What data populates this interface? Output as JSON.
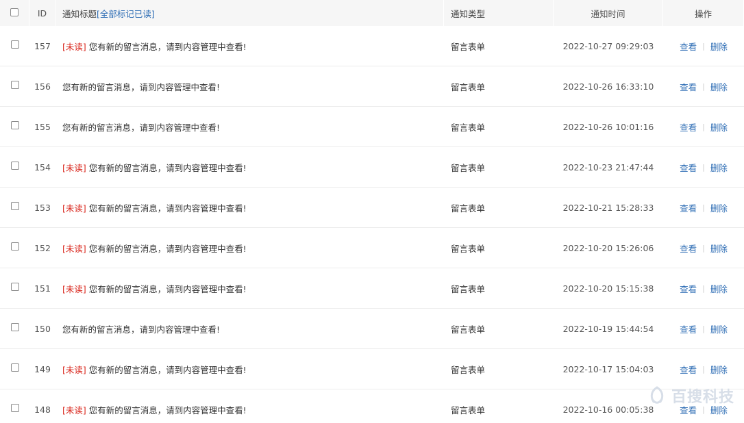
{
  "header": {
    "id_label": "ID",
    "title_label": "通知标题",
    "mark_all_label": "[全部标记已读]",
    "type_label": "通知类型",
    "time_label": "通知时间",
    "ops_label": "操作"
  },
  "unread_label": "[未读]",
  "view_label": "查看",
  "separator": "|",
  "delete_label": "删除",
  "rows": [
    {
      "id": "157",
      "unread": true,
      "title": "您有新的留言消息，请到内容管理中查看!",
      "type": "留言表单",
      "time": "2022-10-27 09:29:03"
    },
    {
      "id": "156",
      "unread": false,
      "title": "您有新的留言消息，请到内容管理中查看!",
      "type": "留言表单",
      "time": "2022-10-26 16:33:10"
    },
    {
      "id": "155",
      "unread": false,
      "title": "您有新的留言消息，请到内容管理中查看!",
      "type": "留言表单",
      "time": "2022-10-26 10:01:16"
    },
    {
      "id": "154",
      "unread": true,
      "title": "您有新的留言消息，请到内容管理中查看!",
      "type": "留言表单",
      "time": "2022-10-23 21:47:44"
    },
    {
      "id": "153",
      "unread": true,
      "title": "您有新的留言消息，请到内容管理中查看!",
      "type": "留言表单",
      "time": "2022-10-21 15:28:33"
    },
    {
      "id": "152",
      "unread": true,
      "title": "您有新的留言消息，请到内容管理中查看!",
      "type": "留言表单",
      "time": "2022-10-20 15:26:06"
    },
    {
      "id": "151",
      "unread": true,
      "title": "您有新的留言消息，请到内容管理中查看!",
      "type": "留言表单",
      "time": "2022-10-20 15:15:38"
    },
    {
      "id": "150",
      "unread": false,
      "title": "您有新的留言消息，请到内容管理中查看!",
      "type": "留言表单",
      "time": "2022-10-19 15:44:54"
    },
    {
      "id": "149",
      "unread": true,
      "title": "您有新的留言消息，请到内容管理中查看!",
      "type": "留言表单",
      "time": "2022-10-17 15:04:03"
    },
    {
      "id": "148",
      "unread": true,
      "title": "您有新的留言消息，请到内容管理中查看!",
      "type": "留言表单",
      "time": "2022-10-16 00:05:38"
    }
  ],
  "watermark": {
    "text": "百搜科技",
    "icon": "baisou-logo-icon"
  },
  "colors": {
    "link": "#2f6eb5",
    "unread": "#d9261c",
    "header_bg": "#f6f6f6"
  }
}
